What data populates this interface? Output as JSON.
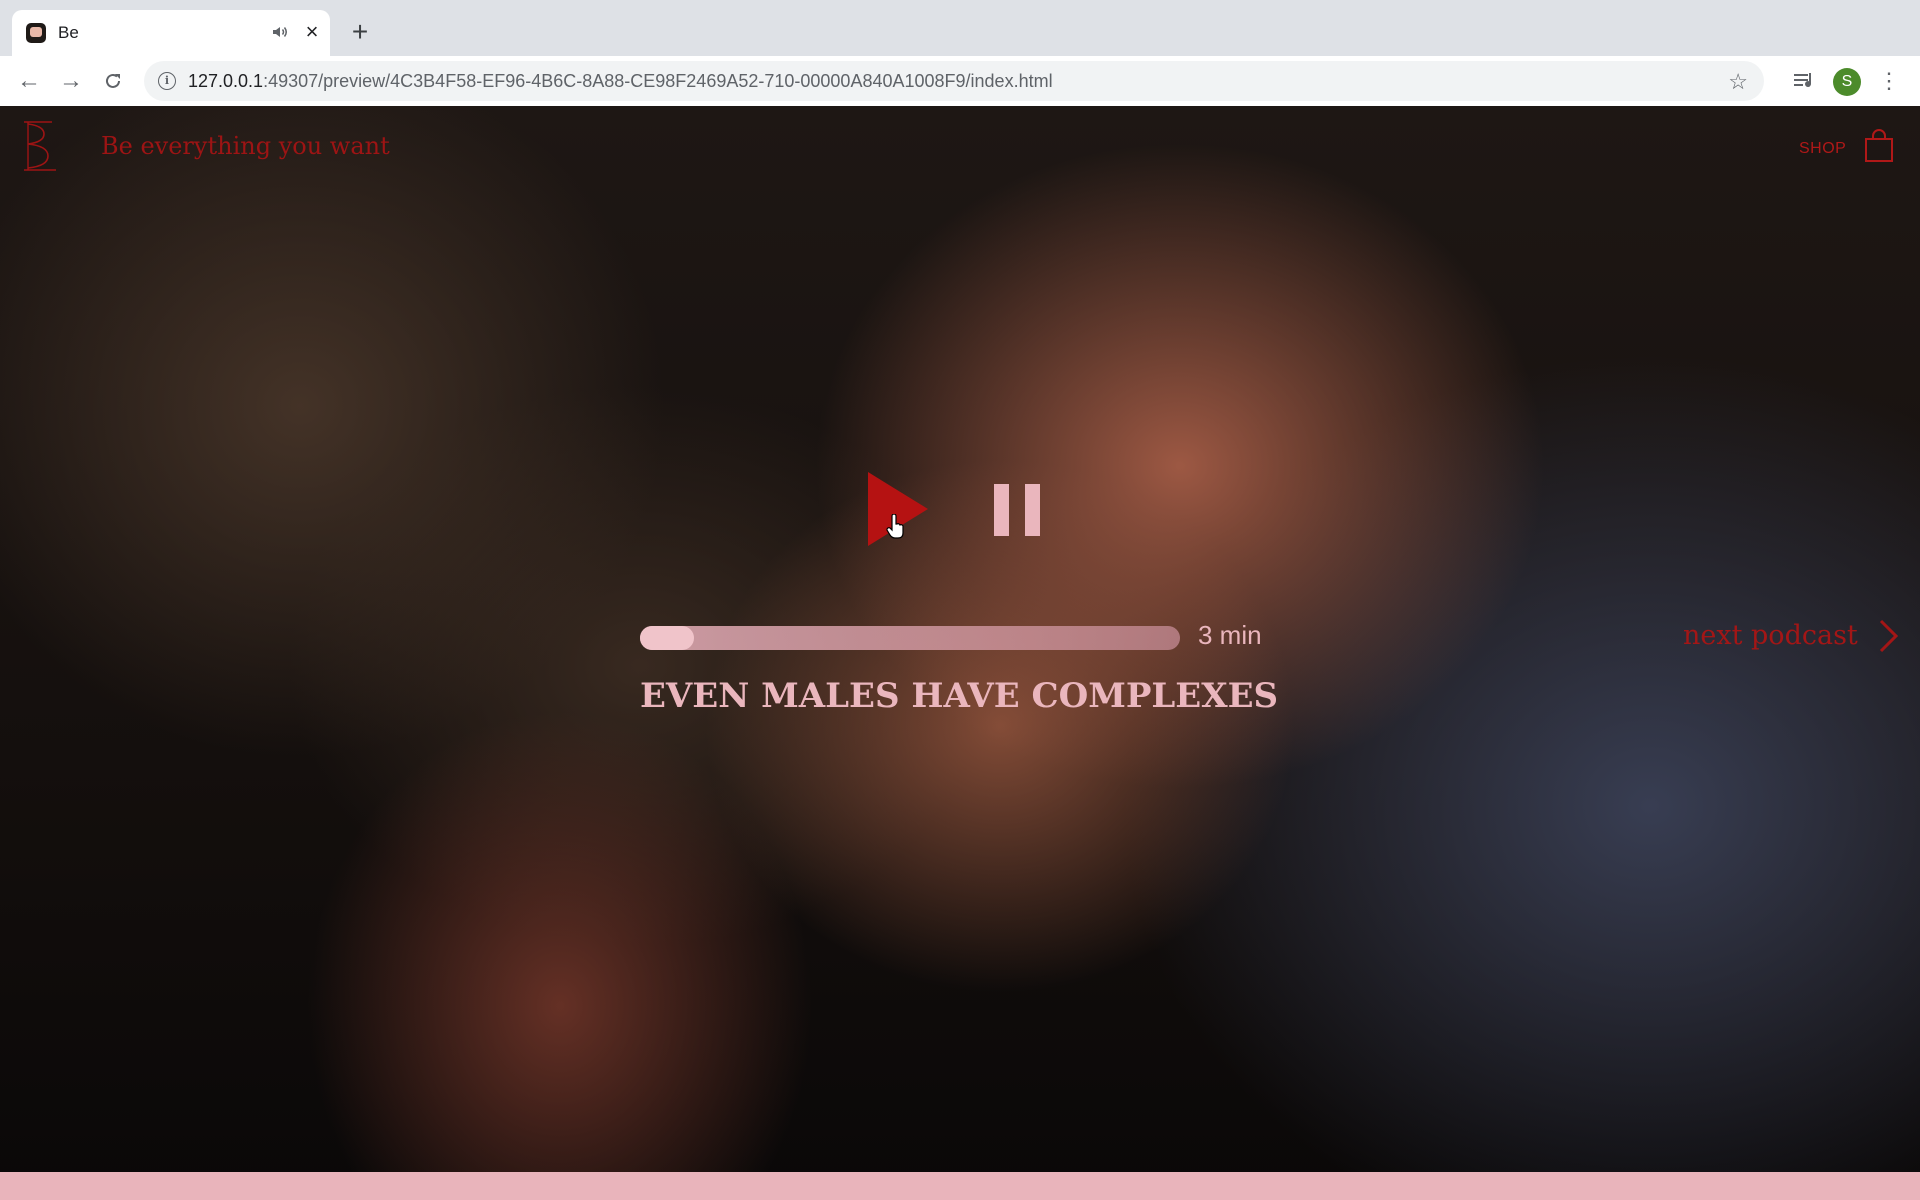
{
  "browser": {
    "tab_title": "Be",
    "url_host": "127.0.0.1",
    "url_rest": ":49307/preview/4C3B4F58-EF96-4B6C-8A88-CE98F2469A52-710-00000A840A1008F9/index.html",
    "profile_initial": "S"
  },
  "header": {
    "tagline": "Be everything you want",
    "shop_label": "SHOP"
  },
  "player": {
    "duration": "3 min",
    "progress": 0.1,
    "episode_title": "EVEN MALES HAVE COMPLEXES",
    "next_label": "next podcast"
  },
  "colors": {
    "brand_red": "#a31616",
    "accent_pink": "#eab6bd"
  },
  "icons": {
    "play": "play-icon",
    "pause": "pause-icon",
    "cart": "shopping-bag-icon",
    "next": "chevron-right-icon"
  }
}
